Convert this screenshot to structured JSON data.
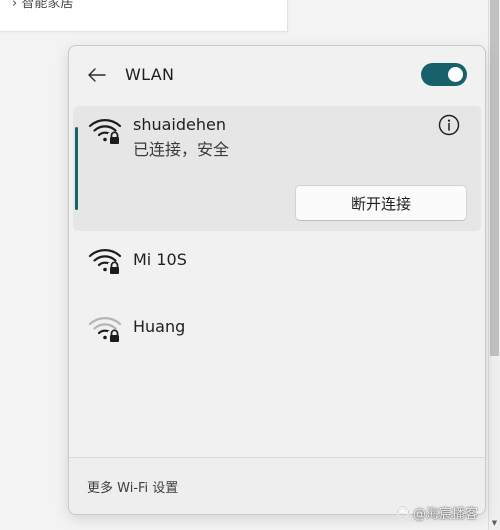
{
  "background": {
    "top_card_text": "› 智能家居"
  },
  "panel": {
    "title": "WLAN",
    "wifi_enabled": true,
    "accent_color": "#18616b",
    "back_icon": "arrow-left-icon",
    "networks": [
      {
        "ssid": "shuaidehen",
        "status": "已连接，安全",
        "secured": true,
        "signal_level": "full",
        "connected": true,
        "disconnect_label": "断开连接",
        "info_icon": "info-icon"
      },
      {
        "ssid": "Mi 10S",
        "secured": true,
        "signal_level": "full",
        "connected": false
      },
      {
        "ssid": "Huang",
        "secured": true,
        "signal_level": "weak",
        "connected": false
      }
    ],
    "footer_link": "更多 Wi-Fi 设置"
  },
  "watermark": {
    "text": "@海宸播客"
  }
}
